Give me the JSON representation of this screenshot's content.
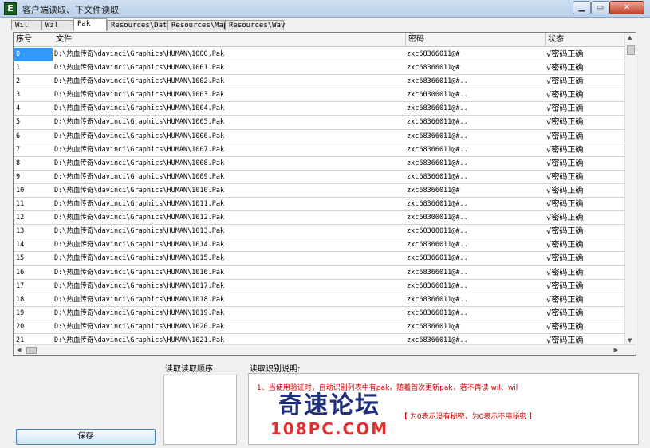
{
  "window": {
    "title": "客户端读取、下文件读取",
    "icon_glyph": "E",
    "min_glyph": "▁",
    "max_glyph": "▭",
    "close_glyph": "✕"
  },
  "tabs": [
    {
      "label": "Wil",
      "active": false
    },
    {
      "label": "Wzl",
      "active": false
    },
    {
      "label": "Pak",
      "active": true
    },
    {
      "label": "Resources\\Data",
      "active": false
    },
    {
      "label": "Resources\\Map",
      "active": false
    },
    {
      "label": "Resources\\Wav",
      "active": false
    }
  ],
  "columns": {
    "index": "序号",
    "file": "文件",
    "password": "密码",
    "status": "状态"
  },
  "rows": [
    {
      "index": "0",
      "file": "D:\\热血传奇\\davinci\\Graphics\\HUMAN\\1000.Pak",
      "password": "zxc68366011@#",
      "status": "√密码正确"
    },
    {
      "index": "1",
      "file": "D:\\热血传奇\\davinci\\Graphics\\HUMAN\\1001.Pak",
      "password": "zxc68366011@#",
      "status": "√密码正确"
    },
    {
      "index": "2",
      "file": "D:\\热血传奇\\davinci\\Graphics\\HUMAN\\1002.Pak",
      "password": "zxc68366011@#..",
      "status": "√密码正确"
    },
    {
      "index": "3",
      "file": "D:\\热血传奇\\davinci\\Graphics\\HUMAN\\1003.Pak",
      "password": "zxc60300011@#..",
      "status": "√密码正确"
    },
    {
      "index": "4",
      "file": "D:\\热血传奇\\davinci\\Graphics\\HUMAN\\1004.Pak",
      "password": "zxc68366011@#..",
      "status": "√密码正确"
    },
    {
      "index": "5",
      "file": "D:\\热血传奇\\davinci\\Graphics\\HUMAN\\1005.Pak",
      "password": "zxc68366011@#..",
      "status": "√密码正确"
    },
    {
      "index": "6",
      "file": "D:\\热血传奇\\davinci\\Graphics\\HUMAN\\1006.Pak",
      "password": "zxc68366011@#..",
      "status": "√密码正确"
    },
    {
      "index": "7",
      "file": "D:\\热血传奇\\davinci\\Graphics\\HUMAN\\1007.Pak",
      "password": "zxc68366011@#..",
      "status": "√密码正确"
    },
    {
      "index": "8",
      "file": "D:\\热血传奇\\davinci\\Graphics\\HUMAN\\1008.Pak",
      "password": "zxc68366011@#..",
      "status": "√密码正确"
    },
    {
      "index": "9",
      "file": "D:\\热血传奇\\davinci\\Graphics\\HUMAN\\1009.Pak",
      "password": "zxc68366011@#..",
      "status": "√密码正确"
    },
    {
      "index": "10",
      "file": "D:\\热血传奇\\davinci\\Graphics\\HUMAN\\1010.Pak",
      "password": "zxc68366011@#",
      "status": "√密码正确"
    },
    {
      "index": "11",
      "file": "D:\\热血传奇\\davinci\\Graphics\\HUMAN\\1011.Pak",
      "password": "zxc68366011@#..",
      "status": "√密码正确"
    },
    {
      "index": "12",
      "file": "D:\\热血传奇\\davinci\\Graphics\\HUMAN\\1012.Pak",
      "password": "zxc60300011@#..",
      "status": "√密码正确"
    },
    {
      "index": "13",
      "file": "D:\\热血传奇\\davinci\\Graphics\\HUMAN\\1013.Pak",
      "password": "zxc60300011@#..",
      "status": "√密码正确"
    },
    {
      "index": "14",
      "file": "D:\\热血传奇\\davinci\\Graphics\\HUMAN\\1014.Pak",
      "password": "zxc68366011@#..",
      "status": "√密码正确"
    },
    {
      "index": "15",
      "file": "D:\\热血传奇\\davinci\\Graphics\\HUMAN\\1015.Pak",
      "password": "zxc68366011@#..",
      "status": "√密码正确"
    },
    {
      "index": "16",
      "file": "D:\\热血传奇\\davinci\\Graphics\\HUMAN\\1016.Pak",
      "password": "zxc68366011@#..",
      "status": "√密码正确"
    },
    {
      "index": "17",
      "file": "D:\\热血传奇\\davinci\\Graphics\\HUMAN\\1017.Pak",
      "password": "zxc68366011@#..",
      "status": "√密码正确"
    },
    {
      "index": "18",
      "file": "D:\\热血传奇\\davinci\\Graphics\\HUMAN\\1018.Pak",
      "password": "zxc68366011@#..",
      "status": "√密码正确"
    },
    {
      "index": "19",
      "file": "D:\\热血传奇\\davinci\\Graphics\\HUMAN\\1019.Pak",
      "password": "zxc68366011@#..",
      "status": "√密码正确"
    },
    {
      "index": "20",
      "file": "D:\\热血传奇\\davinci\\Graphics\\HUMAN\\1020.Pak",
      "password": "zxc68366011@#",
      "status": "√密码正确"
    },
    {
      "index": "21",
      "file": "D:\\热血传奇\\davinci\\Graphics\\HUMAN\\1021.Pak",
      "password": "zxc68366011@#..",
      "status": "√密码正确"
    }
  ],
  "selected_row": 0,
  "scroll": {
    "up": "▲",
    "down": "▼",
    "left": "◀",
    "right": "▶"
  },
  "bottom": {
    "key_label": "读取读取顺序",
    "read_label": "读取识别说明:",
    "read_lines": [
      "1、当使用验证时，自动识别列表中有pak，随着首次更新pak，若不再读 wil、wil",
      "【 为0表示没有秘密，为0表示不用秘密 】"
    ],
    "save_label": "保存"
  },
  "watermark": {
    "top": "奇速论坛",
    "bottom": "108PC.COM"
  },
  "colors": {
    "selection": "#3399ff",
    "notice_red": "#d40000"
  }
}
